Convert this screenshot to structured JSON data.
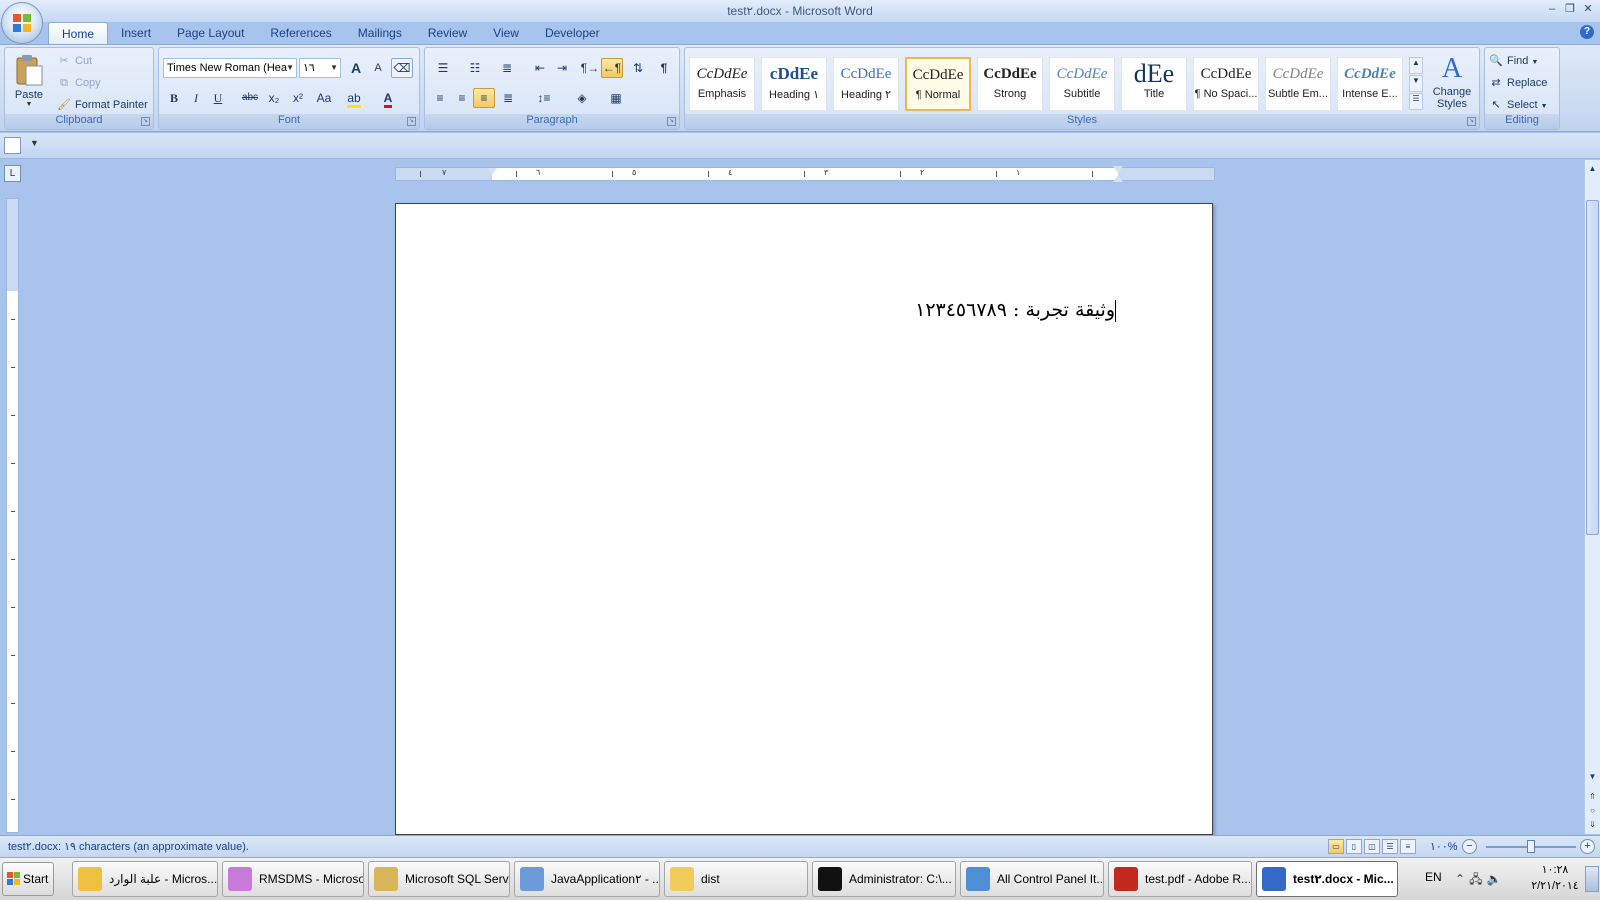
{
  "window": {
    "title": "test٢.docx - Microsoft Word",
    "minimize": "–",
    "restore": "❐",
    "close": "✕"
  },
  "tabs": [
    {
      "label": "Home",
      "active": true
    },
    {
      "label": "Insert"
    },
    {
      "label": "Page Layout"
    },
    {
      "label": "References"
    },
    {
      "label": "Mailings"
    },
    {
      "label": "Review"
    },
    {
      "label": "View"
    },
    {
      "label": "Developer"
    }
  ],
  "clipboard": {
    "group_label": "Clipboard",
    "paste": "Paste",
    "cut": "Cut",
    "copy": "Copy",
    "format_painter": "Format Painter"
  },
  "font": {
    "group_label": "Font",
    "font_name": "Times New Roman (Hea",
    "font_size": "١٦",
    "bold": "B",
    "italic": "I",
    "underline": "U",
    "strike": "abc",
    "subscript": "x₂",
    "superscript": "x²",
    "change_case": "Aa",
    "grow": "A",
    "shrink": "A"
  },
  "paragraph": {
    "group_label": "Paragraph",
    "show_marks": "¶"
  },
  "styles": {
    "group_label": "Styles",
    "items": [
      {
        "sample": "CcDdEe",
        "name": "Emphasis"
      },
      {
        "sample": "cDdEe",
        "name": "Heading ١"
      },
      {
        "sample": "CcDdEe",
        "name": "Heading ٢"
      },
      {
        "sample": "CcDdEe",
        "name": "¶ Normal",
        "selected": true
      },
      {
        "sample": "CcDdEe",
        "name": "Strong"
      },
      {
        "sample": "CcDdEe",
        "name": "Subtitle"
      },
      {
        "sample": "dEe",
        "name": "Title"
      },
      {
        "sample": "CcDdEe",
        "name": "¶ No Spaci..."
      },
      {
        "sample": "CcDdEe",
        "name": "Subtle Em..."
      },
      {
        "sample": "CcDdEe",
        "name": "Intense E..."
      }
    ],
    "change_styles": "Change Styles"
  },
  "editing": {
    "group_label": "Editing",
    "find": "Find",
    "replace": "Replace",
    "select": "Select"
  },
  "ruler": {
    "numbers": [
      "٧",
      "٦",
      "٥",
      "٤",
      "٣",
      "٢",
      "١"
    ]
  },
  "document": {
    "text": "وثيقة تجربة : ١٢٣٤٥٦٧٨٩"
  },
  "status": {
    "text": "test٢.docx: ١٩ characters (an approximate value).",
    "zoom": "١٠٠%",
    "zoom_fraction": 0.5
  },
  "taskbar": {
    "start": "Start",
    "tasks": [
      {
        "label": "علبة الوارد - Micros...",
        "icon": "outlook-icon",
        "color": "#f0c040"
      },
      {
        "label": "RMSDMS - Microso...",
        "icon": "visual-studio-icon",
        "color": "#c87ad8"
      },
      {
        "label": "Microsoft SQL Serv...",
        "icon": "sql-server-icon",
        "color": "#d9b55a"
      },
      {
        "label": "JavaApplication٢ - ...",
        "icon": "netbeans-icon",
        "color": "#6b9ad8"
      },
      {
        "label": "dist",
        "icon": "folder-icon",
        "color": "#f2cc5a"
      },
      {
        "label": "Administrator: C:\\...",
        "icon": "console-icon",
        "color": "#111111"
      },
      {
        "label": "All Control Panel It...",
        "icon": "control-panel-icon",
        "color": "#4f8fd6"
      },
      {
        "label": "test.pdf - Adobe R...",
        "icon": "pdf-icon",
        "color": "#c22a1e"
      },
      {
        "label": "test٢.docx - Mic...",
        "icon": "word-icon",
        "color": "#3569c7",
        "active": true
      }
    ],
    "language": "EN",
    "clock_time": "١٠:٢٨",
    "clock_date": "٢/٢١/٢٠١٤"
  }
}
